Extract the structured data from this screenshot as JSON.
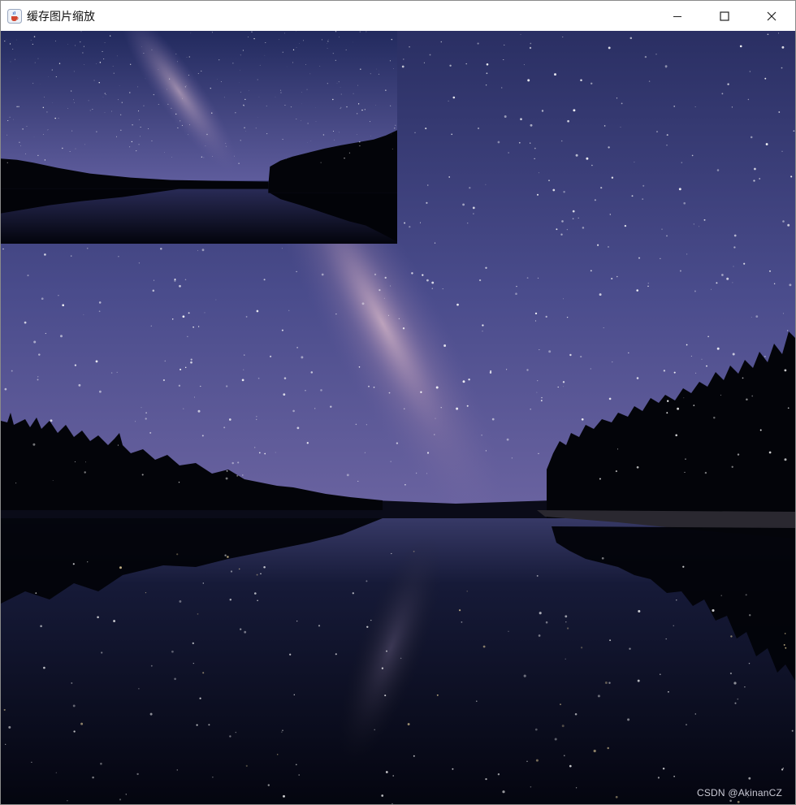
{
  "window": {
    "title": "缓存图片缩放",
    "icon": "java-cup-icon",
    "controls": [
      "minimize-icon",
      "maximize-icon",
      "close-icon"
    ]
  },
  "canvas": {
    "main_image": "night-sky-lake-reflection",
    "thumbnail_image": "night-sky-lake-reflection-scaled",
    "watermark": "CSDN @AkinanCZ"
  },
  "colors": {
    "sky_top": "#2a2f63",
    "sky_bottom": "#5a5a98",
    "water": "#06081a",
    "trees": "#030409"
  }
}
